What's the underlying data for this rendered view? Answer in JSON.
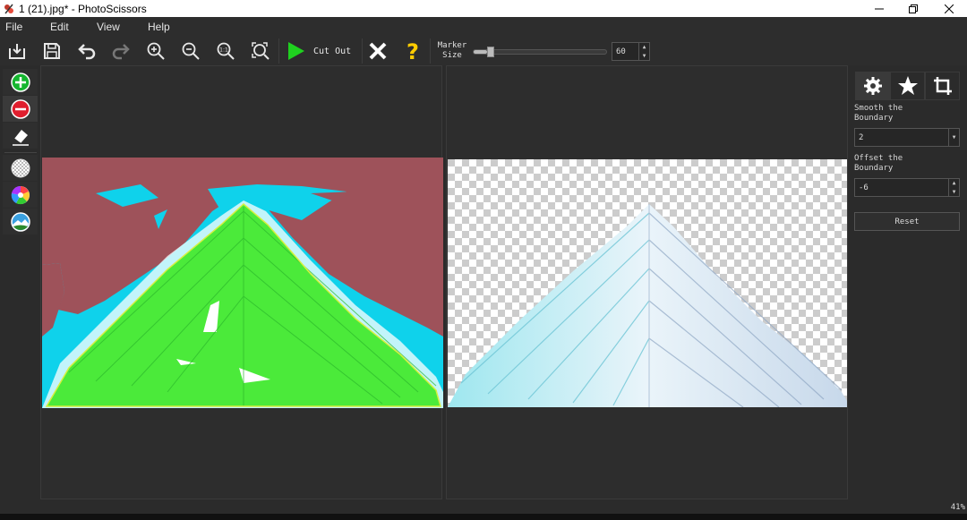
{
  "window": {
    "title": "1 (21).jpg* - PhotoScissors"
  },
  "menu": {
    "file": "File",
    "edit": "Edit",
    "view": "View",
    "help": "Help"
  },
  "toolbar": {
    "cut_out_label": "Cut Out",
    "marker_label_line1": "Marker",
    "marker_label_line2": "Size",
    "marker_size_value": "60",
    "marker_size_level": 0.1,
    "colors": {
      "play": "#1fd11f",
      "help": "#ffcc00"
    }
  },
  "side_panel": {
    "smooth_label_line1": "Smooth the",
    "smooth_label_line2": "Boundary",
    "smooth_value": "2",
    "offset_label_line1": "Offset the",
    "offset_label_line2": "Boundary",
    "offset_value": "-6",
    "reset_label": "Reset"
  },
  "status": {
    "zoom": "41%"
  },
  "colors": {
    "keep_marker": "#4bea3a",
    "background_overlay": "#9e525a",
    "sky": "#0fd2eb",
    "add_tool": "#15b52f",
    "remove_tool": "#e01e2e"
  }
}
